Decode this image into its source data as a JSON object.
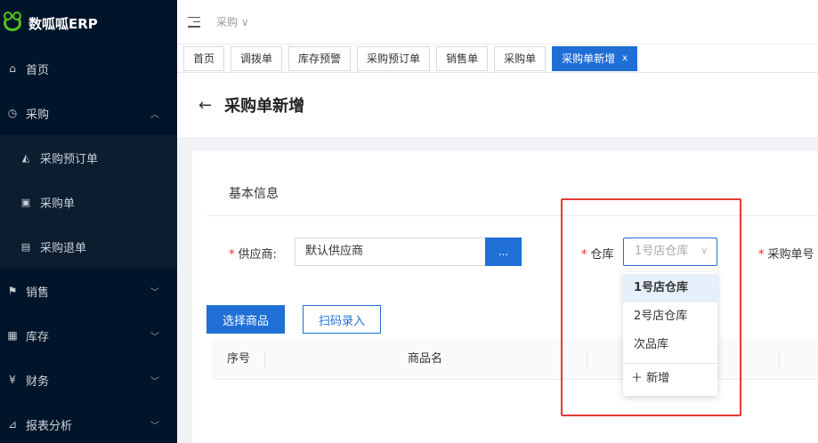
{
  "app": {
    "title": "数呱呱ERP"
  },
  "sidebar": {
    "items": [
      {
        "label": "首页",
        "icon": "home-icon"
      },
      {
        "label": "采购",
        "icon": "clock-icon",
        "expanded": true,
        "children": [
          {
            "label": "采购预订单",
            "icon": "bucket-icon"
          },
          {
            "label": "采购单",
            "icon": "calendar-icon"
          },
          {
            "label": "采购退单",
            "icon": "file-return-icon"
          }
        ]
      },
      {
        "label": "销售",
        "icon": "flag-icon"
      },
      {
        "label": "库存",
        "icon": "warehouse-icon"
      },
      {
        "label": "财务",
        "icon": "yen-icon"
      },
      {
        "label": "报表分析",
        "icon": "chart-icon"
      }
    ]
  },
  "header": {
    "breadcrumb": "采购"
  },
  "tabs": [
    {
      "label": "首页"
    },
    {
      "label": "调拨单"
    },
    {
      "label": "库存预警"
    },
    {
      "label": "采购预订单"
    },
    {
      "label": "销售单"
    },
    {
      "label": "采购单"
    },
    {
      "label": "采购单新增",
      "active": true,
      "close": "x"
    }
  ],
  "page": {
    "title": "采购单新增"
  },
  "form": {
    "section_title": "基本信息",
    "supplier": {
      "label": "供应商:",
      "value": "默认供应商",
      "button": "..."
    },
    "warehouse": {
      "label": "仓库",
      "value": "1号店仓库"
    },
    "order_no": {
      "label": "采购单号"
    }
  },
  "actions": {
    "select_goods": "选择商品",
    "scan_entry": "扫码录入"
  },
  "table": {
    "columns": [
      "序号",
      "商品名"
    ]
  },
  "dropdown": {
    "options": [
      "1号店仓库",
      "2号店仓库",
      "次品库"
    ],
    "selected_index": 0,
    "add_label": "新增"
  },
  "colors": {
    "primary": "#1f6fd6",
    "sidebar": "#001529",
    "highlight": "#e53935"
  }
}
